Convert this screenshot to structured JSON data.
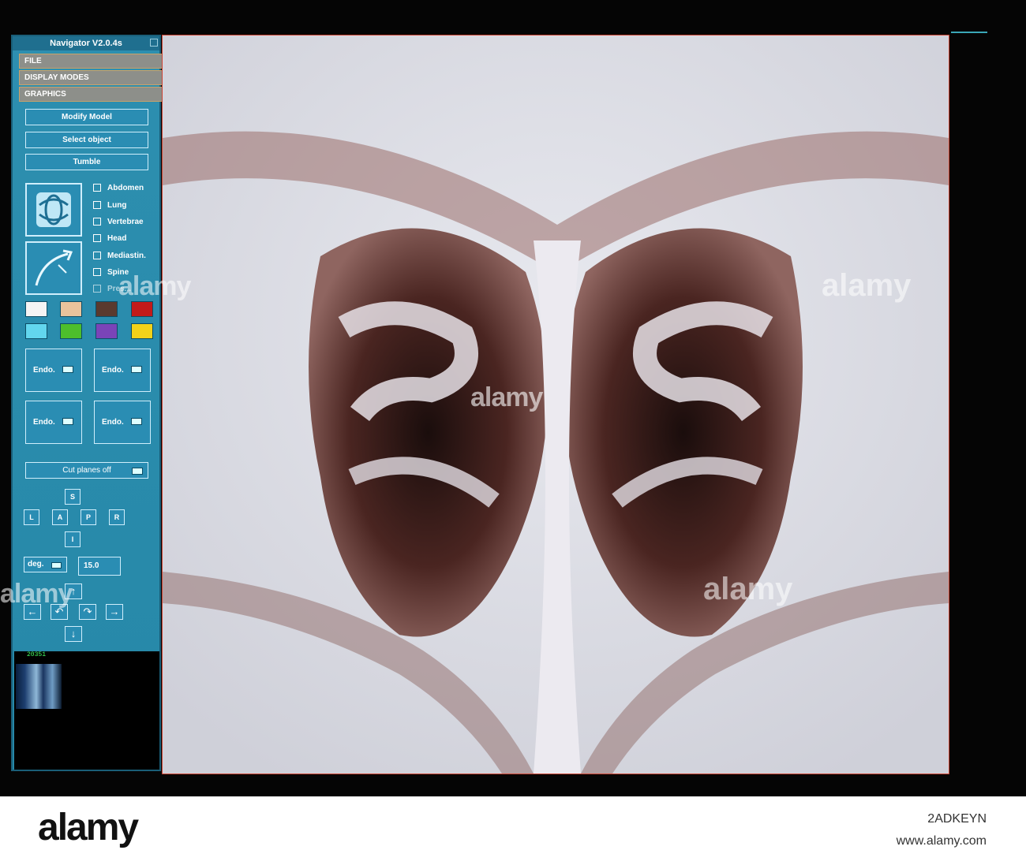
{
  "app": {
    "title": "Navigator V2.0.4s",
    "menus": [
      "FILE",
      "DISPLAY MODES",
      "GRAPHICS"
    ],
    "buttons": {
      "modify": "Modify Model",
      "select": "Select object",
      "tumble": "Tumble"
    },
    "icons": {
      "tumble_icon": "rotate-icon",
      "path_icon": "path-arrow-icon"
    },
    "checkboxes": [
      "Abdomen",
      "Lung",
      "Vertebrae",
      "Head",
      "Mediastin.",
      "Spine",
      "Pres..."
    ],
    "swatches": [
      "#f4f4f4",
      "#e9c39c",
      "#5a3a2e",
      "#c21a1a",
      "#62d6ee",
      "#4dbe2c",
      "#7a44b8",
      "#f2d21a"
    ],
    "modes": [
      "Endo.",
      "Endo.",
      "Endo.",
      "Endo."
    ],
    "cut_planes": "Cut planes off",
    "directions": {
      "s": "S",
      "l": "L",
      "a": "A",
      "p": "P",
      "r": "R",
      "i": "I"
    },
    "units": "deg.",
    "angle": "15.0",
    "frame_counter": "20351"
  },
  "watermark": "alamy",
  "footer": {
    "brand": "alamy",
    "image_id": "2ADKEYN",
    "site": "www.alamy.com"
  }
}
